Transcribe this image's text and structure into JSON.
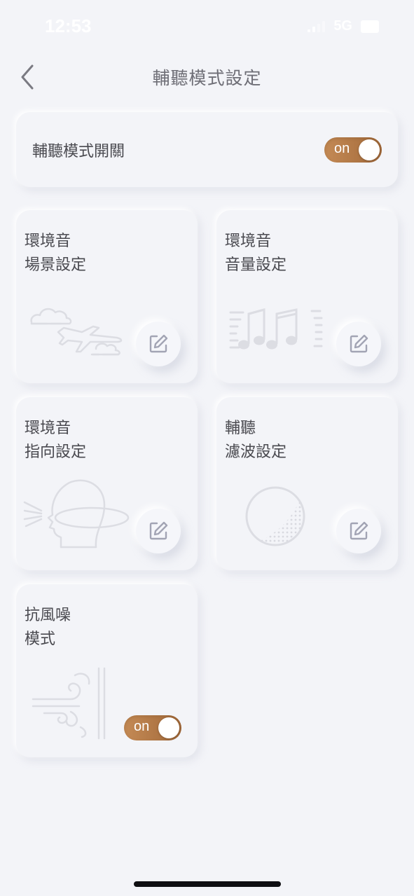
{
  "status_bar": {
    "time": "12:53",
    "network": "5G"
  },
  "header": {
    "title": "輔聽模式設定"
  },
  "master": {
    "label": "輔聽模式開關",
    "toggle": "on"
  },
  "tiles": [
    {
      "line1": "環境音",
      "line2": "場景設定",
      "icon": "airplane-clouds-icon"
    },
    {
      "line1": "環境音",
      "line2": "音量設定",
      "icon": "music-notes-icon"
    },
    {
      "line1": "環境音",
      "line2": "指向設定",
      "icon": "head-direction-icon"
    },
    {
      "line1": "輔聽",
      "line2": "濾波設定",
      "icon": "filter-circle-icon"
    },
    {
      "line1": "抗風噪",
      "line2": "模式",
      "icon": "wind-icon",
      "toggle": "on"
    }
  ],
  "colors": {
    "background": "#f3f4f8",
    "toggle_on": "#b57a46",
    "icon_stroke": "#dcdde3",
    "edit_icon": "#a2a4b4"
  }
}
